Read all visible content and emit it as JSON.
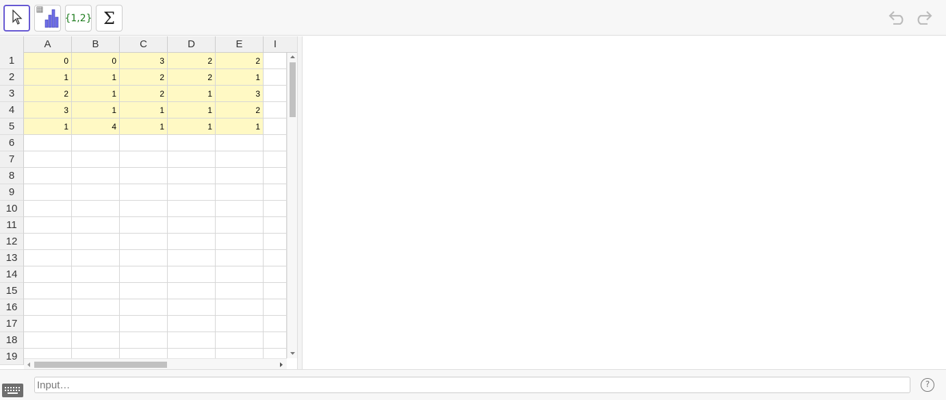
{
  "toolbar": {
    "tools": [
      {
        "name": "move-tool",
        "icon": "cursor-arrow-icon",
        "active": true
      },
      {
        "name": "one-variable-analysis-tool",
        "icon": "bar-chart-icon",
        "active": false
      },
      {
        "name": "create-list-tool",
        "icon": "list-braces-icon",
        "label": "{1,2}",
        "active": false
      },
      {
        "name": "sum-tool",
        "icon": "sigma-icon",
        "label": "Σ",
        "active": false
      }
    ],
    "undo_icon": "undo-icon",
    "redo_icon": "redo-icon"
  },
  "spreadsheet": {
    "columns": [
      "A",
      "B",
      "C",
      "D",
      "E",
      "I"
    ],
    "row_numbers": [
      "1",
      "2",
      "3",
      "4",
      "5",
      "6",
      "7",
      "8",
      "9",
      "10",
      "11",
      "12",
      "13",
      "14",
      "15",
      "16",
      "17",
      "18",
      "19"
    ],
    "rows": [
      [
        "0",
        "0",
        "3",
        "2",
        "2"
      ],
      [
        "1",
        "1",
        "2",
        "2",
        "1"
      ],
      [
        "2",
        "1",
        "2",
        "1",
        "3"
      ],
      [
        "3",
        "1",
        "1",
        "1",
        "2"
      ],
      [
        "1",
        "4",
        "1",
        "1",
        "1"
      ]
    ]
  },
  "input": {
    "placeholder": "Input…"
  },
  "help": {
    "label": "?"
  },
  "colors": {
    "active_tool_border": "#6557d2",
    "filled_cell": "#fff9c4",
    "list_tool_text": "#1a7a1a"
  }
}
